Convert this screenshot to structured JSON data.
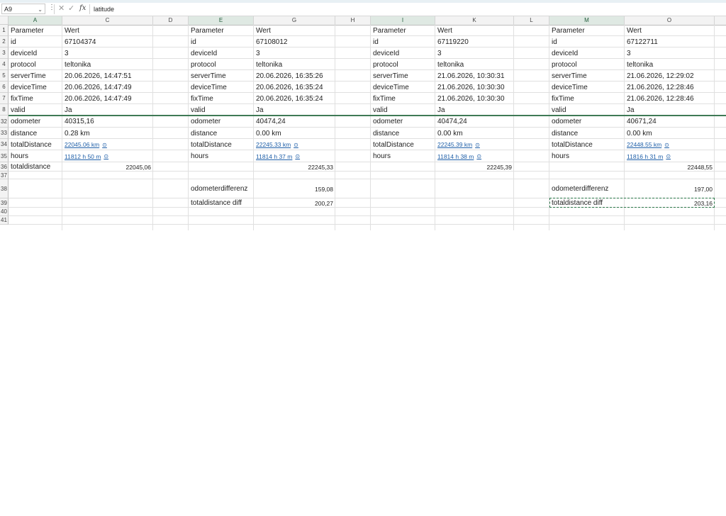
{
  "formula_bar": {
    "name_box": "A9",
    "formula": "latitude",
    "fx_label": "fx"
  },
  "columns": [
    "A",
    "C",
    "D",
    "E",
    "G",
    "H",
    "I",
    "K",
    "L",
    "M",
    "O"
  ],
  "selected_columns": [
    "A",
    "E",
    "I",
    "M"
  ],
  "rows": [
    "1",
    "2",
    "3",
    "4",
    "5",
    "6",
    "7",
    "8",
    "32",
    "33",
    "34",
    "35",
    "36",
    "37",
    "38",
    "39",
    "40",
    "41"
  ],
  "blocks": [
    {
      "param_header": "Parameter",
      "value_header": "Wert",
      "rows": [
        [
          "id",
          "67104374"
        ],
        [
          "deviceId",
          "3"
        ],
        [
          "protocol",
          "teltonika"
        ],
        [
          "serverTime",
          "20.06.2026, 14:47:51"
        ],
        [
          "deviceTime",
          "20.06.2026, 14:47:49"
        ],
        [
          "fixTime",
          "20.06.2026, 14:47:49"
        ],
        [
          "valid",
          "Ja"
        ],
        [
          "odometer",
          "40315,16"
        ],
        [
          "distance",
          "0.28 km"
        ]
      ],
      "totalDistance_label": "totalDistance",
      "totalDistance_link": "22045.06 km",
      "hours_label": "hours",
      "hours_link": "11812 h 50 m",
      "totaldistance_label": "totaldistance",
      "totaldistance_value": "22045,06",
      "diff1_label": "",
      "diff1_value": "",
      "diff2_label": "",
      "diff2_value": ""
    },
    {
      "param_header": "Parameter",
      "value_header": "Wert",
      "rows": [
        [
          "id",
          "67108012"
        ],
        [
          "deviceId",
          "3"
        ],
        [
          "protocol",
          "teltonika"
        ],
        [
          "serverTime",
          "20.06.2026, 16:35:26"
        ],
        [
          "deviceTime",
          "20.06.2026, 16:35:24"
        ],
        [
          "fixTime",
          "20.06.2026, 16:35:24"
        ],
        [
          "valid",
          "Ja"
        ],
        [
          "odometer",
          "40474,24"
        ],
        [
          "distance",
          "0.00 km"
        ]
      ],
      "totalDistance_label": "totalDistance",
      "totalDistance_link": "22245.33 km",
      "hours_label": "hours",
      "hours_link": "11814 h 37 m",
      "totaldistance_label": "",
      "totaldistance_value": "22245,33",
      "diff1_label": "odometerdifferenz",
      "diff1_value": "159,08",
      "diff2_label": "totaldistance diff",
      "diff2_value": "200,27"
    },
    {
      "param_header": "Parameter",
      "value_header": "Wert",
      "rows": [
        [
          "id",
          "67119220"
        ],
        [
          "deviceId",
          "3"
        ],
        [
          "protocol",
          "teltonika"
        ],
        [
          "serverTime",
          "21.06.2026, 10:30:31"
        ],
        [
          "deviceTime",
          "21.06.2026, 10:30:30"
        ],
        [
          "fixTime",
          "21.06.2026, 10:30:30"
        ],
        [
          "valid",
          "Ja"
        ],
        [
          "odometer",
          "40474,24"
        ],
        [
          "distance",
          "0.00 km"
        ]
      ],
      "totalDistance_label": "totalDistance",
      "totalDistance_link": "22245.39 km",
      "hours_label": "hours",
      "hours_link": "11814 h 38 m",
      "totaldistance_label": "",
      "totaldistance_value": "22245,39",
      "diff1_label": "",
      "diff1_value": "",
      "diff2_label": "",
      "diff2_value": ""
    },
    {
      "param_header": "Parameter",
      "value_header": "Wert",
      "rows": [
        [
          "id",
          "67122711"
        ],
        [
          "deviceId",
          "3"
        ],
        [
          "protocol",
          "teltonika"
        ],
        [
          "serverTime",
          "21.06.2026, 12:29:02"
        ],
        [
          "deviceTime",
          "21.06.2026, 12:28:46"
        ],
        [
          "fixTime",
          "21.06.2026, 12:28:46"
        ],
        [
          "valid",
          "Ja"
        ],
        [
          "odometer",
          "40671,24"
        ],
        [
          "distance",
          "0.00 km"
        ]
      ],
      "totalDistance_label": "totalDistance",
      "totalDistance_link": "22448.55 km",
      "hours_label": "hours",
      "hours_link": "11816 h 31 m",
      "totaldistance_label": "",
      "totaldistance_value": "22448,55",
      "diff1_label": "odometerdifferenz",
      "diff1_value": "197,00",
      "diff2_label": "totaldistance diff",
      "diff2_value": "203,16"
    }
  ]
}
